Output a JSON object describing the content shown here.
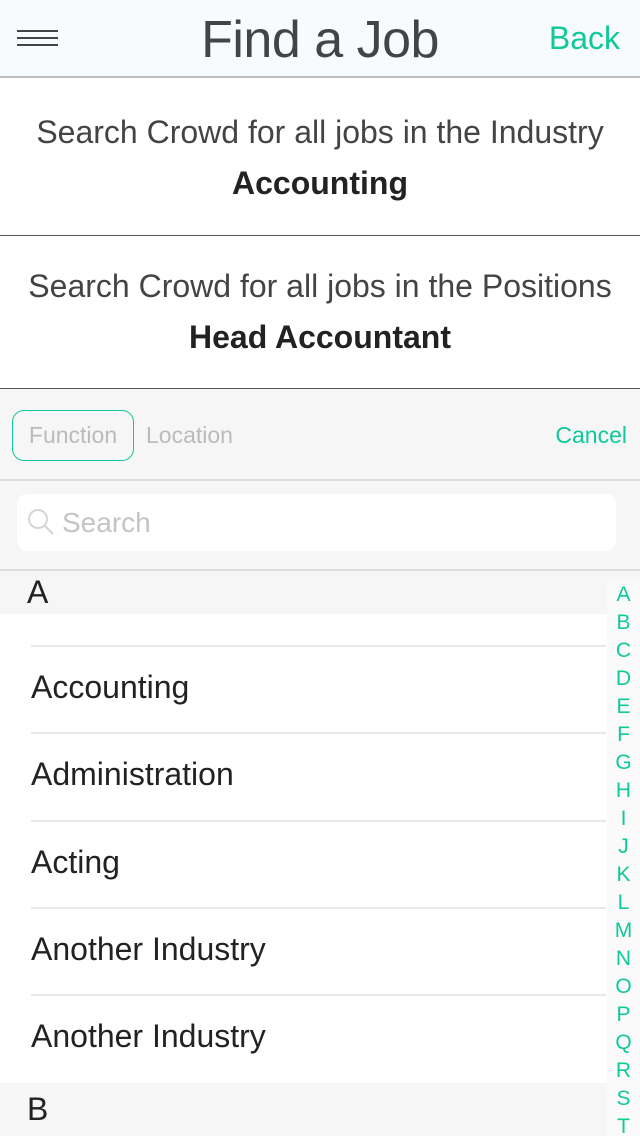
{
  "header": {
    "title": "Find a Job",
    "back_label": "Back"
  },
  "industry": {
    "prompt": "Search Crowd for all jobs in the Industry",
    "value": "Accounting"
  },
  "positions": {
    "prompt": "Search Crowd for all jobs in the Positions",
    "value": "Head Accountant"
  },
  "filter": {
    "tabs": [
      "Function",
      "Location"
    ],
    "cancel_label": "Cancel"
  },
  "search": {
    "placeholder": "Search"
  },
  "sections": [
    {
      "letter": "A",
      "items": [
        "",
        "Accounting",
        "Administration",
        "Acting",
        "Another Industry",
        "Another Industry"
      ]
    },
    {
      "letter": "B"
    }
  ],
  "index": [
    "A",
    "B",
    "C",
    "D",
    "E",
    "F",
    "G",
    "H",
    "I",
    "J",
    "K",
    "L",
    "M",
    "N",
    "O",
    "P",
    "Q",
    "R",
    "S",
    "T"
  ],
  "colors": {
    "accent": "#10c99a"
  }
}
